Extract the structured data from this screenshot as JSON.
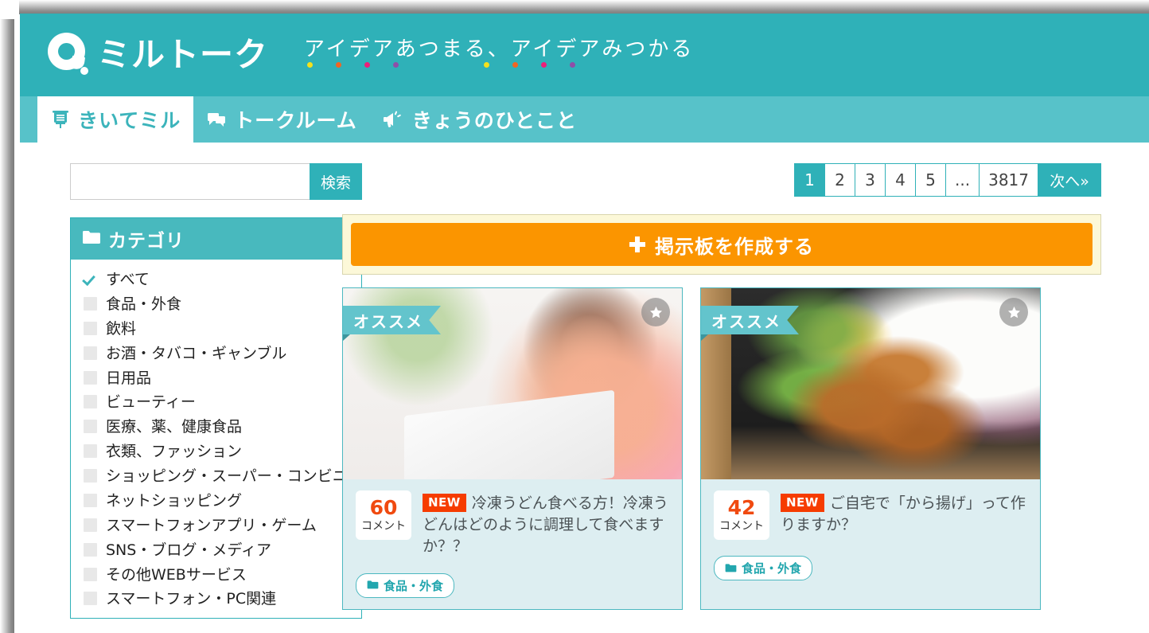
{
  "header": {
    "logo_text": "ミルトーク",
    "tagline": "アイデアあつまる、アイデアみつかる",
    "header_color": "#2fb1b8",
    "nav_color": "#57c2c9",
    "dot_colors": [
      "#f4e11c",
      "#f26522",
      "#ec1e79",
      "#8e4ea8"
    ]
  },
  "nav": {
    "tabs": [
      {
        "label": "きいてミル",
        "icon": "bulletin-board-icon",
        "active": true
      },
      {
        "label": "トークルーム",
        "icon": "chat-bubbles-icon",
        "active": false
      },
      {
        "label": "きょうのひとこと",
        "icon": "megaphone-icon",
        "active": false
      }
    ]
  },
  "search": {
    "value": "",
    "placeholder": "",
    "button_label": "検索"
  },
  "pagination": {
    "pages": [
      "1",
      "2",
      "3",
      "4",
      "5",
      "...",
      "3817"
    ],
    "active": "1",
    "next_label": "次へ»"
  },
  "sidebar": {
    "title": "カテゴリ",
    "icon": "folder-icon",
    "items": [
      {
        "label": "すべて",
        "checked": true
      },
      {
        "label": "食品・外食",
        "checked": false
      },
      {
        "label": "飲料",
        "checked": false
      },
      {
        "label": "お酒・タバコ・ギャンブル",
        "checked": false
      },
      {
        "label": "日用品",
        "checked": false
      },
      {
        "label": "ビューティー",
        "checked": false
      },
      {
        "label": "医療、薬、健康食品",
        "checked": false
      },
      {
        "label": "衣類、ファッション",
        "checked": false
      },
      {
        "label": "ショッピング・スーパー・コンビニ",
        "checked": false
      },
      {
        "label": "ネットショッピング",
        "checked": false
      },
      {
        "label": "スマートフォンアプリ・ゲーム",
        "checked": false
      },
      {
        "label": "SNS・ブログ・メディア",
        "checked": false
      },
      {
        "label": "その他WEBサービス",
        "checked": false
      },
      {
        "label": "スマートフォン・PC関連",
        "checked": false
      }
    ]
  },
  "create_banner": {
    "button_label": "掲示板を作成する",
    "plus_icon": "plus-icon",
    "button_color": "#fb9500",
    "banner_color": "#fcf8d8"
  },
  "cards": [
    {
      "badge": "オススメ",
      "star_icon": "star-icon",
      "comment_count": "60",
      "comment_label": "コメント",
      "new_label": "NEW",
      "title": "冷凍うどん食べる方！冷凍うどんはどのように調理して食べますか？？",
      "category_tag": "食品・外食",
      "photo": "woman-with-laptop-on-floor"
    },
    {
      "badge": "オススメ",
      "star_icon": "star-icon",
      "comment_count": "42",
      "comment_label": "コメント",
      "new_label": "NEW",
      "title": "ご自宅で「から揚げ」って作りますか？",
      "category_tag": "食品・外食",
      "photo": "bento-box-with-karaage"
    }
  ]
}
